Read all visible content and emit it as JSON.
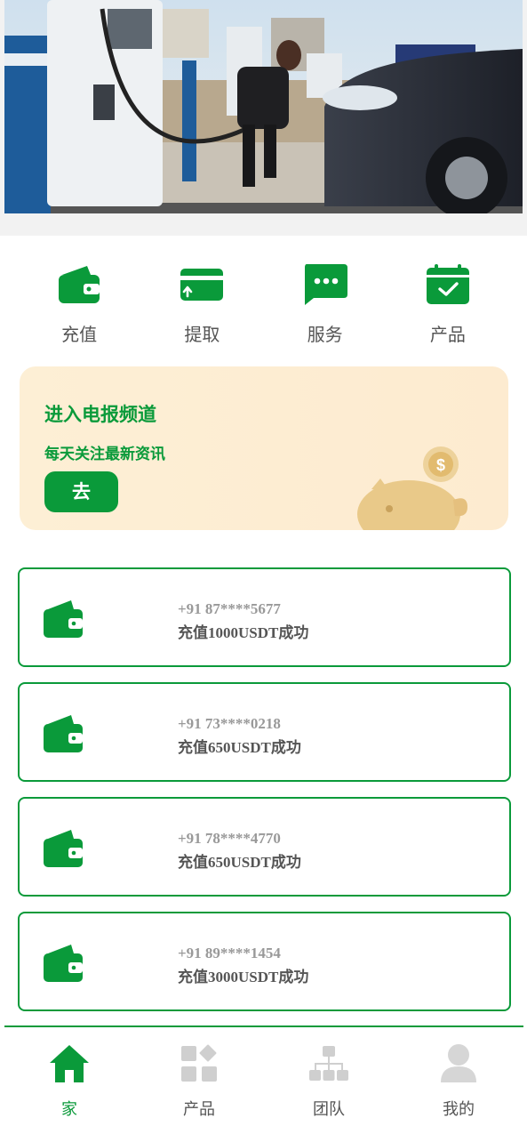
{
  "theme": {
    "accent": "#0a9a3a",
    "promo_bg": "#fdefd5",
    "muted_icon": "#cfcfcf"
  },
  "quick_actions": [
    {
      "label": "充值",
      "icon": "wallet-icon"
    },
    {
      "label": "提取",
      "icon": "card-withdraw-icon"
    },
    {
      "label": "服务",
      "icon": "chat-bubble-icon"
    },
    {
      "label": "产品",
      "icon": "calendar-check-icon"
    }
  ],
  "promo": {
    "title": "进入电报频道",
    "subtitle": "每天关注最新资讯",
    "button_label": "去"
  },
  "records": [
    {
      "phone": "+91 87****5677",
      "message": "充值1000USDT成功"
    },
    {
      "phone": "+91 73****0218",
      "message": "充值650USDT成功"
    },
    {
      "phone": "+91 78****4770",
      "message": "充值650USDT成功"
    },
    {
      "phone": "+91 89****1454",
      "message": "充值3000USDT成功"
    }
  ],
  "bottom_nav": [
    {
      "label": "家",
      "icon": "home-icon",
      "active": true
    },
    {
      "label": "产品",
      "icon": "grid-icon",
      "active": false
    },
    {
      "label": "团队",
      "icon": "org-chart-icon",
      "active": false
    },
    {
      "label": "我的",
      "icon": "user-icon",
      "active": false
    }
  ]
}
